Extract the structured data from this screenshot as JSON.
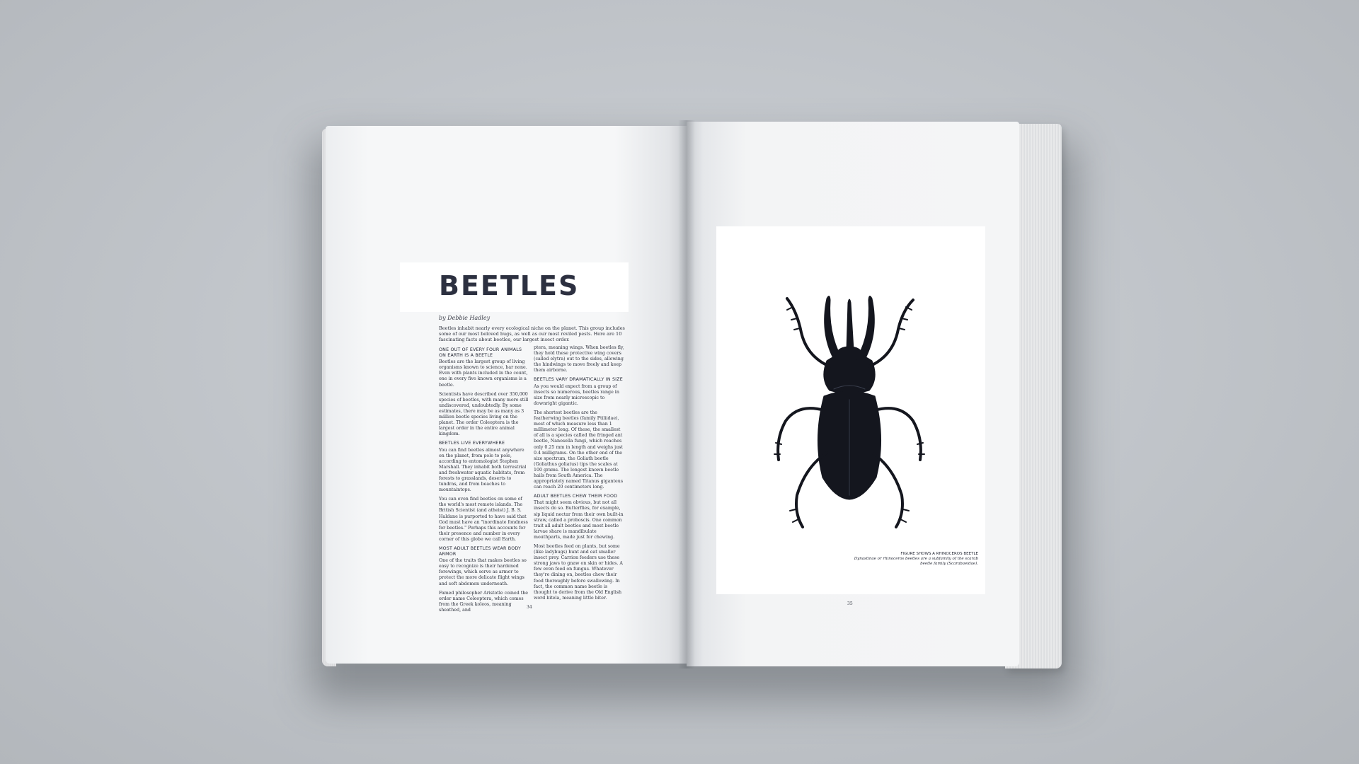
{
  "left_page": {
    "title": "BEETLES",
    "byline": "by Debbie Hadley",
    "intro": "Beetles inhabit nearly every ecological niche on the planet. This group includes some of our most beloved bugs, as well as our most reviled pests. Here are 10 fascinating facts about beetles, our largest insect order.",
    "column_a": [
      {
        "heading": "ONE OUT OF EVERY FOUR ANIMALS ON EARTH IS A BEETLE",
        "paragraphs": [
          "Beetles are the largest group of living organisms known to science, bar none. Even with plants included in the count, one in every five known organisms is a beetle.",
          "Scientists have described over 350,000 species of beetles, with many more still undiscovered, undoubtedly. By some estimates, there may be as many as 3 million beetle species living on the planet. The order Coleoptera is the largest order in the entire animal kingdom."
        ]
      },
      {
        "heading": "BEETLES LIVE EVERYWHERE",
        "paragraphs": [
          "You can find beetles almost anywhere on the planet, from pole to pole, according to entomologist Stephen Marshall. They inhabit both terrestrial and freshwater aquatic habitats, from forests to grasslands, deserts to tundras, and from beaches to mountaintops.",
          "You can even find beetles on some of the world's most remote islands. The British Scientist (and atheist) J. B. S. Haldane is purported to have said that God must have an \"inordinate fondness for beetles.\" Perhaps this accounts for their presence and number in every corner of this globe we call Earth."
        ]
      },
      {
        "heading": "MOST ADULT BEETLES WEAR BODY ARMOR",
        "paragraphs": [
          "One of the traits that makes beetles so easy to recognize is their hardened forewings, which serve as armor to protect the more delicate flight wings and soft abdomen underneath.",
          "Famed philosopher Aristotle coined the order name Coleoptera, which comes from the Greek koleos, meaning sheathed, and"
        ]
      }
    ],
    "column_b": [
      {
        "heading": "",
        "paragraphs": [
          "ptera, meaning wings. When beetles fly, they hold these protective wing covers (called elytra) out to the sides, allowing the hindwings to move freely and keep them airborne."
        ]
      },
      {
        "heading": "BEETLES VARY DRAMATICALLY IN SIZE",
        "paragraphs": [
          "As you would expect from a group of insects so numerous, beetles range in size from nearly microscopic to downright gigantic.",
          "The shortest beetles are the featherwing beetles (family Ptiliidae), most of which measure less than 1 millimeter long. Of these, the smallest of all is a species called the fringed ant beetle, Nanosella fungi, which reaches only 0.25 mm in length and weighs just 0.4 milligrams. On the other end of the size spectrum, the Goliath beetle (Goliathus goliatus) tips the scales at 100 grams. The longest known beetle hails from South America. The appropriately named Titanus giganteus can reach 20 centimeters long."
        ]
      },
      {
        "heading": "ADULT BEETLES CHEW THEIR FOOD",
        "paragraphs": [
          "That might seem obvious, but not all insects do so. Butterflies, for example, sip liquid nectar from their own built-in straw, called a proboscis. One common trait all adult beetles and most beetle larvae share is mandibulate mouthparts, made just for chewing.",
          "Most beetles feed on plants, but some (like ladybugs) hunt and eat smaller insect prey. Carrion feeders use these strong jaws to gnaw on skin or hides. A few even feed on fungus. Whatever they're dining on, beetles chew their food thoroughly before swallowing. In fact, the common name beetle is thought to derive from the Old English word bitela, meaning little biter."
        ]
      }
    ],
    "page_number": "34"
  },
  "right_page": {
    "figure_icon": "rhinoceros-beetle-illustration",
    "caption_head": "FIGURE SHOWS A RHINOCEROS BEETLE",
    "caption_body": "Dynastinae or rhinoceros beetles are a subfamily of the scarab beetle family (Scarabaeidae).",
    "page_number": "35"
  },
  "colors": {
    "background": "#c2c6cb",
    "title_text": "#2c3040",
    "beetle_body": "#14161e"
  }
}
